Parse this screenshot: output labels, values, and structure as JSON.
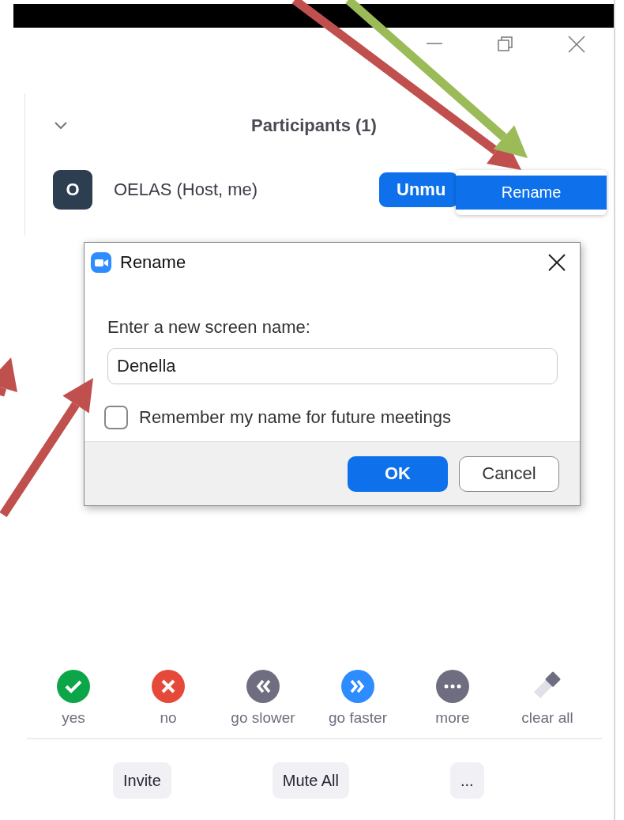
{
  "window_controls": [
    {
      "kind": "minimize"
    },
    {
      "kind": "restore"
    },
    {
      "kind": "close"
    }
  ],
  "participants": {
    "title": "Participants (1)",
    "expanded": true,
    "rows": [
      {
        "initial": "O",
        "name": "OELAS (Host, me)",
        "button": "Unmu"
      }
    ]
  },
  "context_menu": {
    "items": [
      {
        "label": "Rename",
        "selected": true
      }
    ]
  },
  "dialog": {
    "title": "Rename",
    "label": "Enter a new screen name:",
    "value": "Denella",
    "checkbox": {
      "label": "Remember my name for future meetings",
      "checked": false
    },
    "buttons": [
      {
        "label": "OK",
        "kind": "primary"
      },
      {
        "label": "Cancel",
        "kind": "secondary"
      }
    ]
  },
  "reactions": [
    {
      "kind": "yes",
      "label": "yes"
    },
    {
      "kind": "no",
      "label": "no"
    },
    {
      "kind": "slower",
      "label": "go slower"
    },
    {
      "kind": "faster",
      "label": "go faster"
    },
    {
      "kind": "more",
      "label": "more"
    },
    {
      "kind": "clear",
      "label": "clear all"
    }
  ],
  "footer_buttons": [
    "Invite",
    "Mute All",
    "..."
  ],
  "annotations": [
    {
      "kind": "arrow",
      "color": "#c0504d"
    },
    {
      "kind": "arrow",
      "color": "#9bbb59"
    },
    {
      "kind": "arrow",
      "color": "#c0504d"
    },
    {
      "kind": "arrow",
      "color": "#c0504d"
    }
  ]
}
